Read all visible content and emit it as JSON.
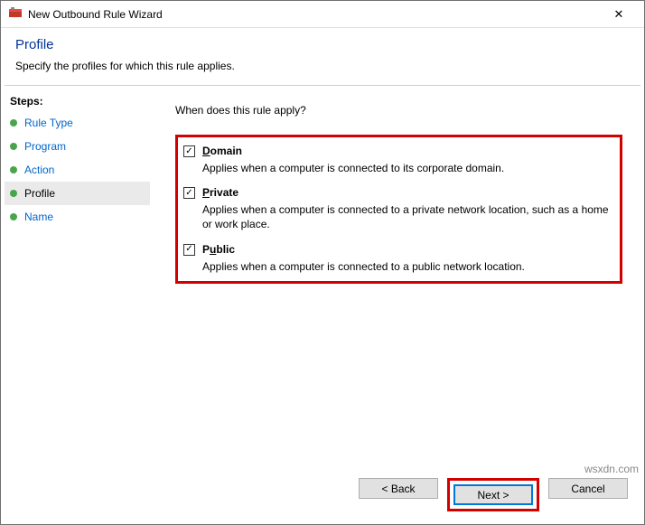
{
  "window": {
    "title": "New Outbound Rule Wizard"
  },
  "header": {
    "title": "Profile",
    "desc": "Specify the profiles for which this rule applies."
  },
  "sidebar": {
    "heading": "Steps:",
    "items": [
      {
        "label": "Rule Type"
      },
      {
        "label": "Program"
      },
      {
        "label": "Action"
      },
      {
        "label": "Profile"
      },
      {
        "label": "Name"
      }
    ]
  },
  "content": {
    "prompt": "When does this rule apply?",
    "checkboxes": [
      {
        "letter": "D",
        "rest": "omain",
        "desc": "Applies when a computer is connected to its corporate domain."
      },
      {
        "letter": "P",
        "rest": "rivate",
        "desc": "Applies when a computer is connected to a private network location, such as a home or work place."
      },
      {
        "letter": "u",
        "pre": "P",
        "rest": "blic",
        "desc": "Applies when a computer is connected to a public network location."
      }
    ]
  },
  "footer": {
    "back": "< Back",
    "next": "Next >",
    "cancel": "Cancel"
  },
  "watermark": "wsxdn.com"
}
